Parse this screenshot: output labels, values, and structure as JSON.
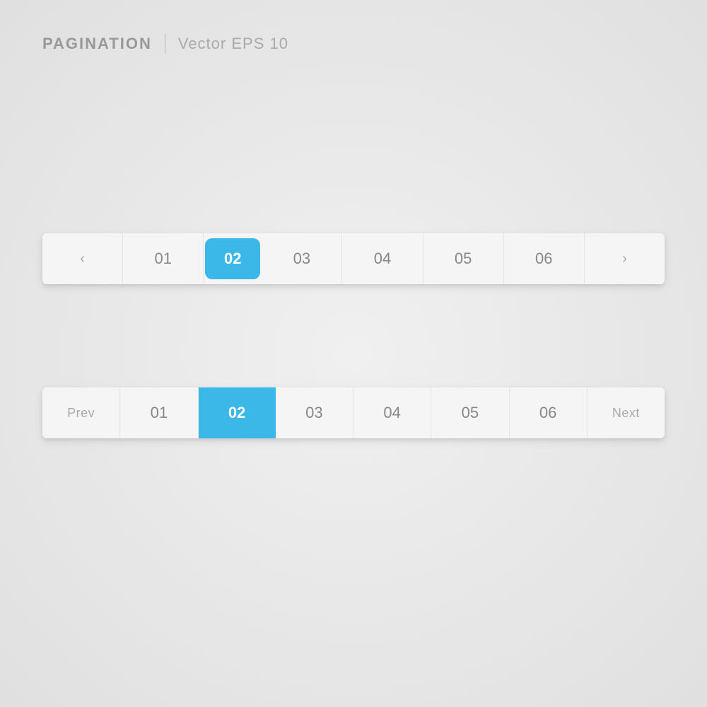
{
  "header": {
    "title": "PAGINATION",
    "subtitle": "Vector EPS 10"
  },
  "bar1": {
    "items": [
      {
        "label": "‹",
        "type": "arrow",
        "active": false,
        "name": "prev"
      },
      {
        "label": "01",
        "type": "page",
        "active": false,
        "name": "page-01"
      },
      {
        "label": "02",
        "type": "page",
        "active": true,
        "name": "page-02"
      },
      {
        "label": "03",
        "type": "page",
        "active": false,
        "name": "page-03"
      },
      {
        "label": "04",
        "type": "page",
        "active": false,
        "name": "page-04"
      },
      {
        "label": "05",
        "type": "page",
        "active": false,
        "name": "page-05"
      },
      {
        "label": "06",
        "type": "page",
        "active": false,
        "name": "page-06"
      },
      {
        "label": "›",
        "type": "arrow",
        "active": false,
        "name": "next"
      }
    ]
  },
  "bar2": {
    "items": [
      {
        "label": "Prev",
        "type": "prev-next",
        "active": false,
        "name": "prev"
      },
      {
        "label": "01",
        "type": "page",
        "active": false,
        "name": "page-01"
      },
      {
        "label": "02",
        "type": "page",
        "active": true,
        "name": "page-02"
      },
      {
        "label": "03",
        "type": "page",
        "active": false,
        "name": "page-03"
      },
      {
        "label": "04",
        "type": "page",
        "active": false,
        "name": "page-04"
      },
      {
        "label": "05",
        "type": "page",
        "active": false,
        "name": "page-05"
      },
      {
        "label": "06",
        "type": "page",
        "active": false,
        "name": "page-06"
      },
      {
        "label": "Next",
        "type": "prev-next",
        "active": false,
        "name": "next"
      }
    ]
  },
  "colors": {
    "active_bg": "#3bb8e8",
    "bar_bg": "#f5f5f5"
  }
}
